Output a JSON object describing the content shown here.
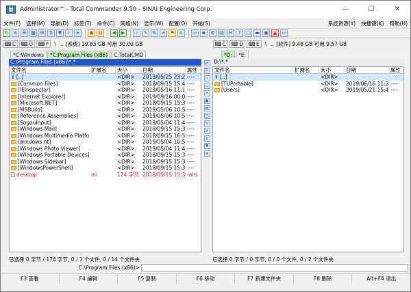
{
  "window": {
    "title": "Administrator^ - Total Commander 9.50 - SINAI Engineering Corp.",
    "minimize": "—",
    "maximize": "☐",
    "close": "✕"
  },
  "menu": {
    "left": [
      "文件(F)",
      "选择(M)",
      "导航(D)",
      "标签(T)",
      "命令(C)",
      "网络(N)",
      "显示(W)",
      "配置(O)",
      "开始(S)"
    ],
    "right": [
      "系统资源(Y)",
      "快捷键(K)",
      "帮助(H)"
    ]
  },
  "left_drive": {
    "star": "*",
    "drive": "C",
    "letters": [
      "D",
      "F"
    ],
    "path_sep": "\\",
    "up": "..",
    "info": "[系统]  19.83 GB 可用 30.00 GB"
  },
  "right_drive": {
    "star": "*",
    "drive": "D",
    "letters": [
      "C",
      "E"
    ],
    "path_sep": "\\",
    "up": "..",
    "info": "[软件]  9.48 GB 可用 9.57 GB"
  },
  "left_tabs": [
    "*C:Windows",
    "*C:Program Files (x86)",
    "C:TotalCMD"
  ],
  "right_tabs": [
    "*D:",
    "*E:"
  ],
  "left_path": "C:\\Program Files (x86)\\*.*",
  "right_path": "D:\\*.*",
  "columns": {
    "name": "文件名",
    "ext": "扩展名",
    "size": "大小",
    "date": "日期",
    "attr": "属性"
  },
  "left_files": [
    {
      "name": "[..]",
      "ext": "",
      "size": "<DIR>",
      "date": "2019/05/25 23:26",
      "attr": "----",
      "kind": "up"
    },
    {
      "name": "[Common Files]",
      "ext": "",
      "size": "<DIR>",
      "date": "2018/09/15 15:42",
      "attr": "----",
      "kind": "folder"
    },
    {
      "name": "[IEInspector]",
      "ext": "",
      "size": "<DIR>",
      "date": "2019/05/16 11:12",
      "attr": "----",
      "kind": "folder"
    },
    {
      "name": "[Internet Explorer]",
      "ext": "",
      "size": "<DIR>",
      "date": "2019/09/16 00:04",
      "attr": "----",
      "kind": "folder"
    },
    {
      "name": "[Microsoft.NET]",
      "ext": "",
      "size": "<DIR>",
      "date": "2018/09/15 15:33",
      "attr": "----",
      "kind": "folder"
    },
    {
      "name": "[MSBuild]",
      "ext": "",
      "size": "<DIR>",
      "date": "2019/05/06 10:50",
      "attr": "----",
      "kind": "folder"
    },
    {
      "name": "[Reference Assemblies]",
      "ext": "",
      "size": "<DIR>",
      "date": "2019/05/06 10:50",
      "attr": "----",
      "kind": "folder"
    },
    {
      "name": "[SogouInput]",
      "ext": "",
      "size": "<DIR>",
      "date": "2019/05/04 11:44",
      "attr": "----",
      "kind": "folder"
    },
    {
      "name": "[Windows Mail]",
      "ext": "",
      "size": "<DIR>",
      "date": "2018/09/15 15:33",
      "attr": "----",
      "kind": "folder"
    },
    {
      "name": "[Windows Multimedia Platform]",
      "ext": "",
      "size": "<DIR>",
      "date": "2018/09/15 16:56",
      "attr": "----",
      "kind": "folder"
    },
    {
      "name": "[windows nt]",
      "ext": "",
      "size": "<DIR>",
      "date": "2019/05/04 10:50",
      "attr": "----",
      "kind": "folder"
    },
    {
      "name": "[Windows Photo Viewer]",
      "ext": "",
      "size": "<DIR>",
      "date": "2019/05/04 11:44",
      "attr": "----",
      "kind": "folder"
    },
    {
      "name": "[Windows Portable Devices]",
      "ext": "",
      "size": "<DIR>",
      "date": "2018/09/15 15:33",
      "attr": "----",
      "kind": "folder"
    },
    {
      "name": "[Windows Sidebar]",
      "ext": "",
      "size": "<DIR>",
      "date": "2018/09/15 15:33",
      "attr": "----",
      "kind": "folder"
    },
    {
      "name": "[WindowsPowerShell]",
      "ext": "",
      "size": "<DIR>",
      "date": "2018/09/15 15:33",
      "attr": "----",
      "kind": "folder"
    },
    {
      "name": "desktop",
      "ext": "ini",
      "size": "174 字节",
      "date": "2018/09/15 15:31",
      "attr": "-ahs",
      "kind": "file"
    }
  ],
  "right_files": [
    {
      "name": "[..]",
      "ext": "",
      "size": "<DIR>",
      "date": "",
      "attr": "",
      "kind": "up"
    },
    {
      "name": "[TUPortable]",
      "ext": "",
      "size": "<DIR>",
      "date": "2019/06/16 11:28",
      "attr": "----",
      "kind": "folder"
    },
    {
      "name": "[Users]",
      "ext": "",
      "size": "<DIR>",
      "date": "2019/05/21 15:47",
      "attr": "----",
      "kind": "folder"
    }
  ],
  "left_status": "已选择 0 字节 / 174 字节, 0 / 1 个文件, 0 / 14 个文件夹",
  "right_status": "已选择 0 字节 / 0 字节, 0 / 0 个文件, 0 / 2 个文件夹",
  "cmd_label": "C:\\Program Files (x86)>",
  "fkeys": [
    "F3 查看",
    "F4 编辑",
    "F5 复制",
    "F6 移动",
    "F7 新建文件夹",
    "F8 删除",
    "Alt+F4 退出"
  ],
  "colors": {
    "active_path_bg": "#1c56c9",
    "selected_row": "#cde8ff",
    "active_tab": "#c8ecc0",
    "hidden_file": "#c62020"
  }
}
